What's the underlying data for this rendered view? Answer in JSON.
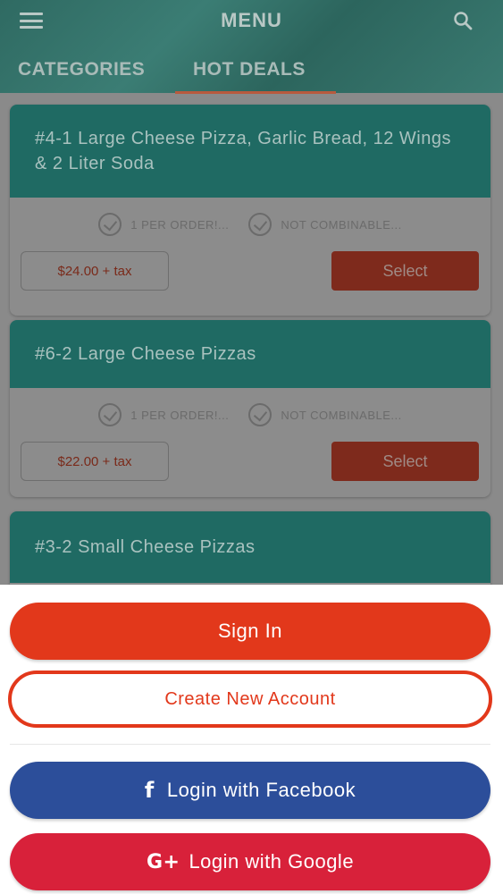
{
  "header": {
    "title": "MENU",
    "tabs": [
      {
        "label": "CATEGORIES"
      },
      {
        "label": "HOT DEALS"
      }
    ]
  },
  "deals": [
    {
      "title": "#4-1 Large Cheese  Pizza, Garlic  Bread, 12 Wings  & 2 Liter Soda",
      "badge1": "1 PER ORDER!...",
      "badge2": "NOT COMBINABLE...",
      "price": "$24.00 + tax",
      "select_label": "Select"
    },
    {
      "title": "#6-2 Large  Cheese  Pizzas",
      "badge1": "1 PER ORDER!...",
      "badge2": "NOT COMBINABLE...",
      "price": "$22.00 + tax",
      "select_label": "Select"
    },
    {
      "title": "#3-2 Small  Cheese  Pizzas"
    }
  ],
  "sheet": {
    "signin_label": "Sign In",
    "create_label": "Create New Account",
    "facebook_label": "Login with Facebook",
    "google_label": "Login with Google"
  },
  "icons": {
    "facebook_glyph": "f",
    "google_glyph": "G+"
  },
  "colors": {
    "teal": "#1f6a63",
    "primary_red": "#e2381b",
    "facebook_blue": "#2c4e9a",
    "google_red": "#d8213a"
  }
}
